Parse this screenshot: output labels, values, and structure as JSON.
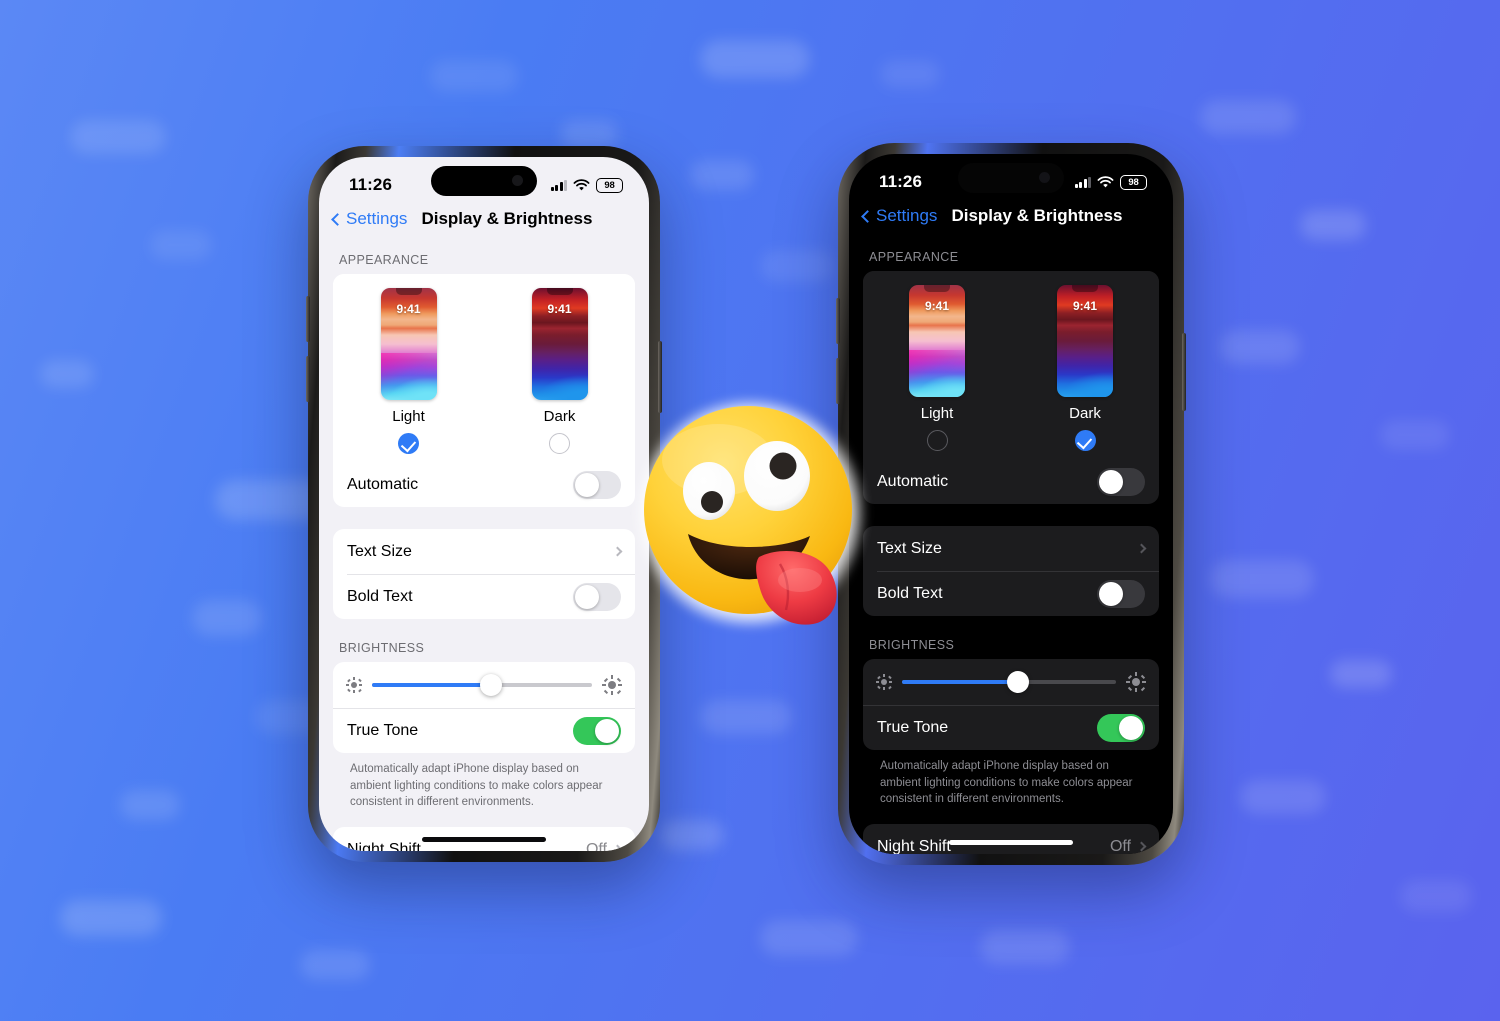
{
  "background": {
    "gradient_from": "#5b88f5",
    "gradient_to": "#5a63ee"
  },
  "emoji": {
    "name": "zany-face-emoji",
    "glyph": "🤪",
    "face_color": "#ffc83d",
    "tongue_color": "#e8394a"
  },
  "phones": [
    {
      "id": "light",
      "theme": "Light",
      "status_bar": {
        "time": "11:26",
        "battery": "98",
        "signal_icon": "cellular-icon",
        "wifi_icon": "wifi-icon"
      },
      "nav": {
        "back_label": "Settings",
        "title": "Display & Brightness"
      },
      "appearance": {
        "section_header": "APPEARANCE",
        "options": [
          {
            "label": "Light",
            "thumb_time": "9:41",
            "selected": true
          },
          {
            "label": "Dark",
            "thumb_time": "9:41",
            "selected": false
          }
        ],
        "automatic_label": "Automatic",
        "automatic_on": false
      },
      "text": {
        "text_size_label": "Text Size",
        "bold_text_label": "Bold Text",
        "bold_text_on": false
      },
      "brightness": {
        "section_header": "BRIGHTNESS",
        "level_percent": 54,
        "true_tone_label": "True Tone",
        "true_tone_on": true,
        "footnote": "Automatically adapt iPhone display based on ambient lighting conditions to make colors appear consistent in different environments."
      },
      "night_shift": {
        "label": "Night Shift",
        "value": "Off"
      }
    },
    {
      "id": "dark",
      "theme": "Dark",
      "status_bar": {
        "time": "11:26",
        "battery": "98",
        "signal_icon": "cellular-icon",
        "wifi_icon": "wifi-icon"
      },
      "nav": {
        "back_label": "Settings",
        "title": "Display & Brightness"
      },
      "appearance": {
        "section_header": "APPEARANCE",
        "options": [
          {
            "label": "Light",
            "thumb_time": "9:41",
            "selected": false
          },
          {
            "label": "Dark",
            "thumb_time": "9:41",
            "selected": true
          }
        ],
        "automatic_label": "Automatic",
        "automatic_on": false
      },
      "text": {
        "text_size_label": "Text Size",
        "bold_text_label": "Bold Text",
        "bold_text_on": false
      },
      "brightness": {
        "section_header": "BRIGHTNESS",
        "level_percent": 54,
        "true_tone_label": "True Tone",
        "true_tone_on": true,
        "footnote": "Automatically adapt iPhone display based on ambient lighting conditions to make colors appear consistent in different environments."
      },
      "night_shift": {
        "label": "Night Shift",
        "value": "Off"
      }
    }
  ],
  "colors": {
    "accent_blue": "#2f7bf6",
    "toggle_green": "#34c759",
    "light_bg": "#f2f1f6",
    "dark_bg": "#000000"
  }
}
